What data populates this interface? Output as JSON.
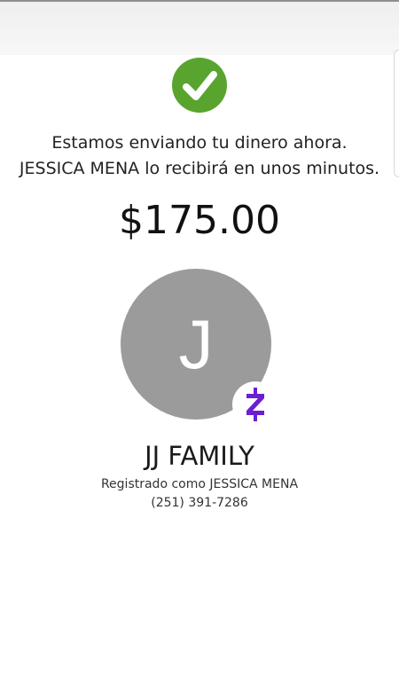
{
  "confirmation": {
    "icon": "checkmark-circle-icon",
    "accent_color": "#59a42f",
    "message": "Estamos enviando tu dinero ahora. JESSICA MENA lo recibirá en unos minutos."
  },
  "payment": {
    "amount": "$175.00"
  },
  "recipient": {
    "initial": "J",
    "avatar_color": "#9b9b9b",
    "badge_icon": "zelle-logo-icon",
    "badge_color": "#6d1ed4",
    "name": "JJ FAMILY",
    "registered_as": "Registrado como JESSICA MENA",
    "phone": "(251) 391-7286"
  }
}
